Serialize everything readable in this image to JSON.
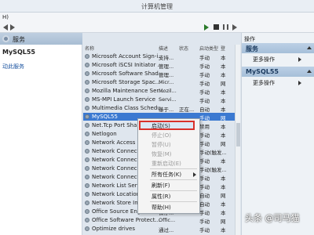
{
  "window": {
    "title": "计算机管理"
  },
  "menubar": {
    "label": "H)"
  },
  "left_pane": {
    "header": "服务",
    "selected_service": "MySQL55",
    "action_link": "动此服务"
  },
  "columns": {
    "name": "名称",
    "description": "描述",
    "status": "状态",
    "startup": "启动类型",
    "logon": "登"
  },
  "services": [
    {
      "name": "Microsoft Account Sign-i...",
      "desc": "支持...",
      "status": "",
      "startup": "手动",
      "logon": "本"
    },
    {
      "name": "Microsoft iSCSI Initiator ...",
      "desc": "管理...",
      "status": "",
      "startup": "手动",
      "logon": "本"
    },
    {
      "name": "Microsoft Software Shad...",
      "desc": "管理...",
      "status": "",
      "startup": "手动",
      "logon": "本"
    },
    {
      "name": "Microsoft Storage Spac...",
      "desc": "Micr...",
      "status": "",
      "startup": "手动",
      "logon": "网"
    },
    {
      "name": "Mozilla Maintenance Ser...",
      "desc": "Mozil...",
      "status": "",
      "startup": "手动",
      "logon": "本"
    },
    {
      "name": "MS-MPI Launch Service",
      "desc": "Servi...",
      "status": "",
      "startup": "手动",
      "logon": "本"
    },
    {
      "name": "Multimedia Class Schedu...",
      "desc": "基于...",
      "status": "正在...",
      "startup": "自动",
      "logon": "本"
    },
    {
      "name": "MySQL55",
      "desc": "",
      "status": "",
      "startup": "手动",
      "logon": "网"
    },
    {
      "name": "Net.Tcp Port Sharin...",
      "desc": "",
      "status": "",
      "startup": "禁用",
      "logon": "本"
    },
    {
      "name": "Netlogon",
      "desc": "",
      "status": "",
      "startup": "手动",
      "logon": "本"
    },
    {
      "name": "Network Access Pr...",
      "desc": "",
      "status": "",
      "startup": "手动",
      "logon": "网"
    },
    {
      "name": "Network Connecte...",
      "desc": "",
      "status": "",
      "startup": "手动(触发...",
      "logon": ""
    },
    {
      "name": "Network Connectio...",
      "desc": "",
      "status": "",
      "startup": "手动",
      "logon": "本"
    },
    {
      "name": "Network Connectio...",
      "desc": "",
      "status": "",
      "startup": "手动(触发...",
      "logon": ""
    },
    {
      "name": "Network Connectiv...",
      "desc": "",
      "status": "",
      "startup": "手动",
      "logon": "本"
    },
    {
      "name": "Network List Servic...",
      "desc": "",
      "status": "",
      "startup": "手动",
      "logon": "本"
    },
    {
      "name": "Network Location A...",
      "desc": "",
      "status": "",
      "startup": "自动",
      "logon": "网"
    },
    {
      "name": "Network Store Int...",
      "desc": "",
      "status": "",
      "startup": "自动",
      "logon": "本"
    },
    {
      "name": "Office Source Engine",
      "desc": "保存...",
      "status": "",
      "startup": "手动",
      "logon": "本"
    },
    {
      "name": "Office Software Protect...",
      "desc": "Offic...",
      "status": "",
      "startup": "手动",
      "logon": "网"
    },
    {
      "name": "Optimize drives",
      "desc": "通过...",
      "status": "",
      "startup": "手动",
      "logon": "本"
    }
  ],
  "context_menu": {
    "start": "启动(S)",
    "stop": "停止(O)",
    "pause": "暂停(U)",
    "resume": "恢复(M)",
    "restart": "重新启动(E)",
    "all_tasks": "所有任务(K)",
    "refresh": "刷新(F)",
    "properties": "属性(R)",
    "help": "帮助(H)"
  },
  "right_pane": {
    "title": "操作",
    "section1": "服务",
    "more1": "更多操作",
    "section2": "MySQL55",
    "more2": "更多操作"
  },
  "watermark": "头条 @司马猫"
}
